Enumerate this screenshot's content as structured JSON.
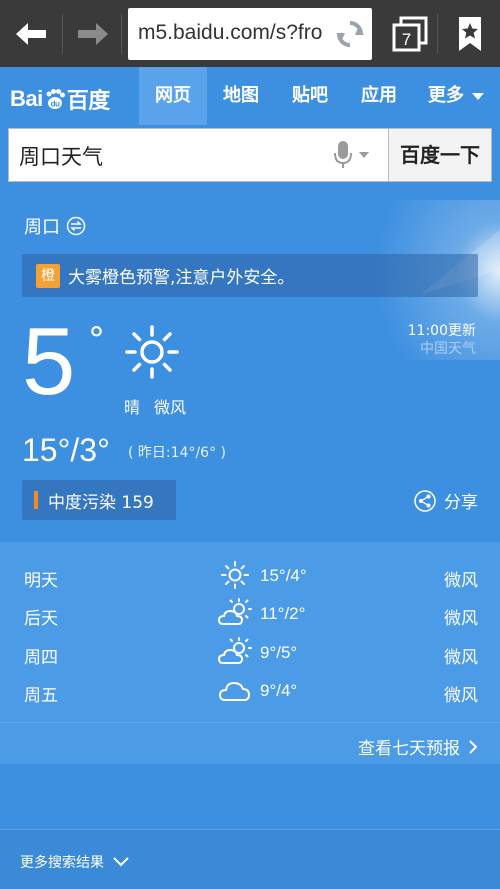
{
  "browser": {
    "url": "m5.baidu.com/s?fro",
    "tabs_count": "7"
  },
  "header": {
    "logo_left": "Bai",
    "logo_right": "百度",
    "tabs": [
      {
        "label": "网页",
        "active": true
      },
      {
        "label": "地图",
        "active": false
      },
      {
        "label": "贴吧",
        "active": false
      },
      {
        "label": "应用",
        "active": false
      },
      {
        "label": "更多",
        "active": false
      }
    ]
  },
  "search": {
    "query": "周口天气",
    "button_label": "百度一下"
  },
  "weather": {
    "city": "周口",
    "alert_badge": "橙",
    "alert_text": "大雾橙色预警,注意户外安全。",
    "current_temp": "5",
    "degree": "°",
    "condition": "晴",
    "wind": "微风",
    "update_time": "11:00更新",
    "source": "中国天气",
    "range": "15°/3°",
    "yesterday": "( 昨日:14°/6° )",
    "aqi": "中度污染 159",
    "share": "分享"
  },
  "forecast": [
    {
      "day": "明天",
      "icon": "sun-icon",
      "temps": "15°/4°",
      "wind": "微风"
    },
    {
      "day": "后天",
      "icon": "sun-cloud-icon",
      "temps": "11°/2°",
      "wind": "微风"
    },
    {
      "day": "周四",
      "icon": "sun-cloud-icon",
      "temps": "9°/5°",
      "wind": "微风"
    },
    {
      "day": "周五",
      "icon": "cloud-icon",
      "temps": "9°/4°",
      "wind": "微风"
    }
  ],
  "week_link": "查看七天预报",
  "more_results": "更多搜索结果",
  "colors": {
    "background": "#3d8fe0",
    "browser_bar": "#3a3a3a",
    "alert_badge": "#f5a234",
    "aqi_bar": "#f58b1f"
  }
}
